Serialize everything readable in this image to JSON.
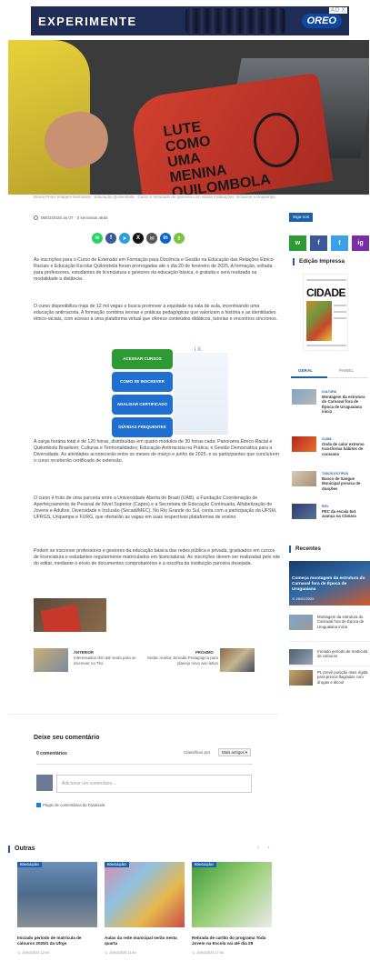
{
  "ad": {
    "headline": "EXPERIMENTE",
    "brand": "OREO",
    "close": "AD X"
  },
  "hero": {
    "shirt_text": "LUTE\nCOMO\nUMA\nMENINA\nQUILOMBOLA",
    "caption": "Bruna Penis Imagem Ilustrativa · Educação Quilombola · Curso é resultado de parceria com várias instituições, inclusive a Unipampa"
  },
  "meta": {
    "date": "06/02/2025 às 07 · 3 semanas atrás"
  },
  "share": [
    {
      "icon": "whatsapp-icon",
      "glyph": "w",
      "color": "#25d366"
    },
    {
      "icon": "facebook-icon",
      "glyph": "f",
      "color": "#3b5998"
    },
    {
      "icon": "telegram-icon",
      "glyph": "➤",
      "color": "#2a9fd8"
    },
    {
      "icon": "x-icon",
      "glyph": "X",
      "color": "#111111"
    },
    {
      "icon": "email-icon",
      "glyph": "✉",
      "color": "#555555"
    },
    {
      "icon": "linkedin-icon",
      "glyph": "in",
      "color": "#0a66c2"
    },
    {
      "icon": "share-icon",
      "glyph": "⇪",
      "color": "#7cc142"
    }
  ],
  "article": {
    "p1": "As inscrições para o Curso de Extensão em Formação para Docência e Gestão na Educação das Relações Étnico-Raciais e Educação Escolar Quilombola foram prorrogadas até o dia 20 de fevereiro de 2025. A formação, voltada para professores, estudantes de licenciatura e gestores da educação básica, é gratuita e será realizada na modalidade a distância.",
    "p2": "O curso disponibiliza mais de 12 mil vagas e busca promover a equidade na sala de aula, incentivando uma educação antirracista. A formação combina teorias e práticas pedagógicas que valorizam a história e as identidades étnico-raciais, com acesso a uma plataforma virtual que oferece conteúdos didáticos, tutorias e encontros síncronos.",
    "p3": "A carga horária total é de 120 horas, distribuídas em quatro módulos de 30 horas cada: Panorama Étnico-Racial e Quilombola Brasileiro; Culturas e Territorialidades; Educação Antirracista na Prática; e Gestão Democrática para a Diversidade. As atividades acontecerão entre os meses de março e junho de 2025, e os participantes que concluírem o curso receberão certificado de extensão.",
    "p4": "O curso é fruto de uma parceria entre a Universidade Aberta do Brasil (UAB), a Fundação Coordenação de Aperfeiçoamento de Pessoal de Nível Superior (Capes) e a Secretaria de Educação Continuada, Alfabetização de Jovens e Adultos, Diversidade e Inclusão (Secadi/MEC). No Rio Grande do Sul, conta com a participação da UFSM, UFRGS, Unipampa e FURG, que ofertarão as vagas em suas respectivas plataformas de ensino.",
    "p5": "Podem se inscrever professores e gestores da educação básica das redes pública e privada, graduados em cursos de licenciatura e estudantes regularmente matriculados em licenciaturas. As inscrições devem ser realizadas pelo site do edital, mediante o envio de documentos comprobatórios e a escolha da instituição parceira desejada."
  },
  "inline_ad": {
    "badge": "i X",
    "buttons": [
      {
        "label": "Acessar cursos",
        "color": "#2e9a34"
      },
      {
        "label": "Como se inscrever",
        "color": "#1f6fd1"
      },
      {
        "label": "Analisar certificado",
        "color": "#1f6fd1"
      },
      {
        "label": "Dúvidas frequentes",
        "color": "#1f6fd1"
      }
    ]
  },
  "prev": {
    "label": "ANTERIOR",
    "title": "Interessados têm até sexta para se inscrever no Tiro"
  },
  "next": {
    "label": "PRÓXIMO",
    "title": "Sedac realiza Jornada Pedagógica para planejo novo ano letivo"
  },
  "comments": {
    "title": "Deixe seu comentário",
    "count": "0 comentários",
    "sort_label": "Classificar por",
    "sort_value": "Mais antigos ▾",
    "placeholder": "Adicionar um comentário...",
    "plugin": "Plugin de comentários do Facebook"
  },
  "outras": {
    "title": "Outras",
    "nav": "‹ ›",
    "cards": [
      {
        "tag": "EDUCAÇÃO",
        "title": "Iniciado período de matrícula de calouros 2025/1 da Ufrgs",
        "date": "20/02/2025 12:00"
      },
      {
        "tag": "EDUCAÇÃO",
        "title": "Aulas da rede municipal serão nesta quarta",
        "date": "20/02/2025 11:40"
      },
      {
        "tag": "EDUCAÇÃO",
        "title": "Retirada de cartão do programa Toda Jovem na Escola vai até dia 28",
        "date": "20/02/2025 17:54"
      }
    ]
  },
  "sidebar": {
    "follow_tag": "Siga-nos",
    "social": [
      {
        "icon": "whatsapp-icon",
        "glyph": "w",
        "color": "#2e9a34"
      },
      {
        "icon": "facebook-icon",
        "glyph": "f",
        "color": "#3b5998"
      },
      {
        "icon": "twitter-icon",
        "glyph": "t",
        "color": "#3aa1e8"
      },
      {
        "icon": "instagram-icon",
        "glyph": "ig",
        "color": "#7a2ea5"
      }
    ],
    "edition_title": "Edição Impressa",
    "newspaper_name": "CIDADE",
    "tabs": {
      "geral": "GERAL",
      "painel": "PAINEL"
    },
    "geral_items": [
      {
        "cat": "CULTURA",
        "title": "Montagem da estrutura do Carnaval fora de Época de Uruguaiana inicia"
      },
      {
        "cat": "CLIMA",
        "title": "Onda de calor extremo transforma hábitos de consumo"
      },
      {
        "cat": "TODOS OS TIPOS",
        "title": "Banco de Sangue Municipal precisa de doações"
      },
      {
        "cat": "RGV",
        "title": "PEC da escala 6x1 avança na Câmara"
      }
    ],
    "recentes_title": "Recentes",
    "recent_feature": {
      "title": "Começa montagem da estrutura do Carnaval fora de Época de Uruguaiana",
      "date": "⊙ 26/02/2025"
    },
    "recent_items": [
      {
        "title": "Montagem da estrutura do Carnaval fora de Época de Uruguaiana inicia"
      },
      {
        "title": "Iniciado período de matrícula de calouros"
      },
      {
        "title": "PL prevê punição mais rígida para presos flagrados com drogas e álcool"
      }
    ]
  }
}
